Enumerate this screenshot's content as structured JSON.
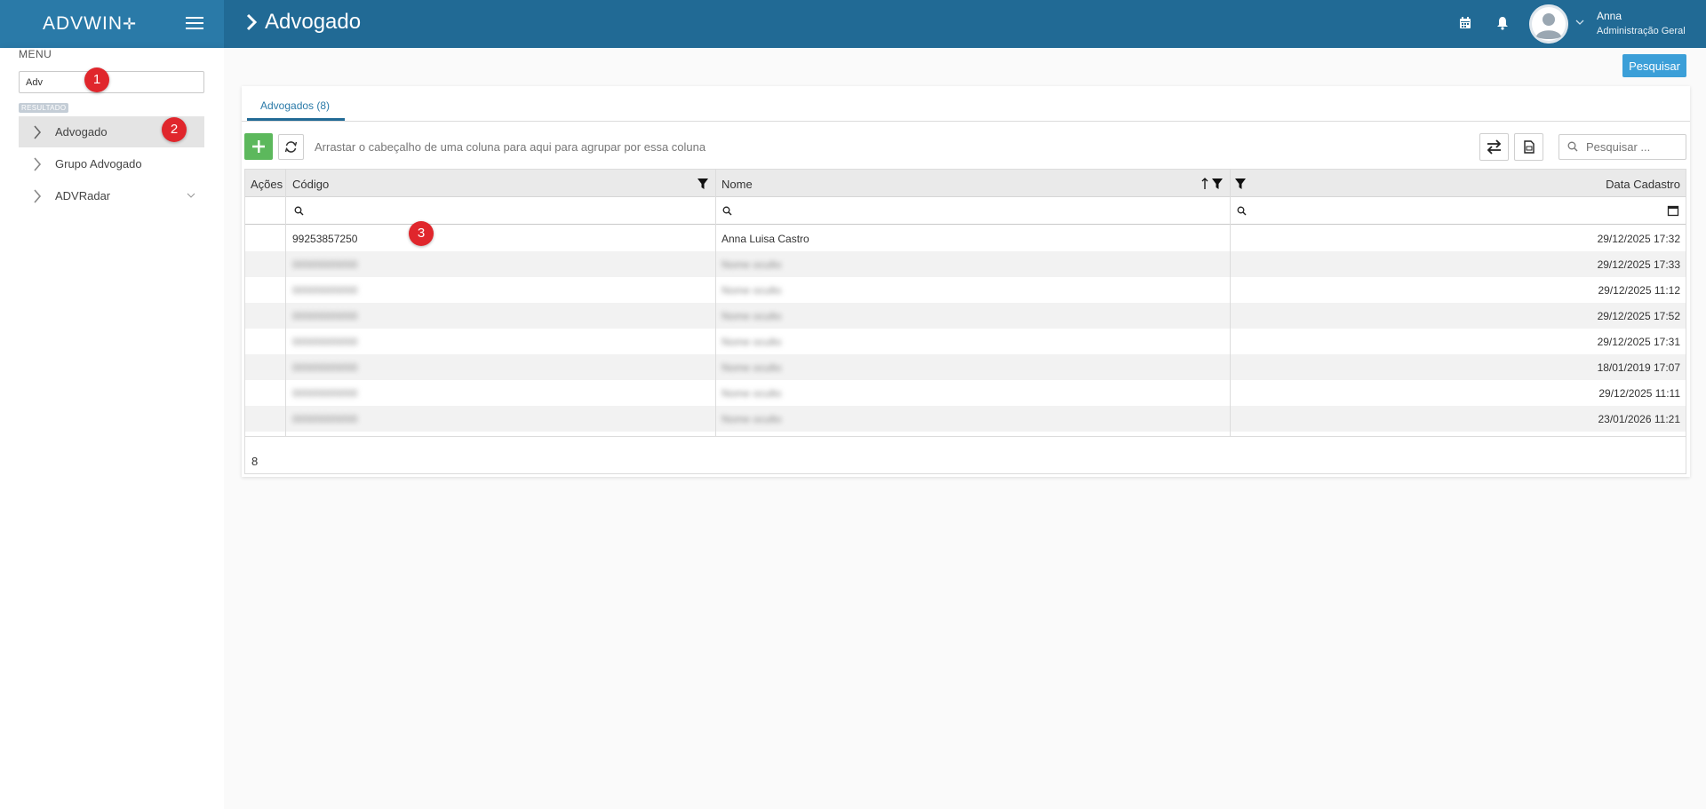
{
  "header": {
    "logo": "ADVWIN",
    "page_title": "Advogado",
    "user": {
      "name": "Anna",
      "role": "Administração Geral"
    }
  },
  "sidebar": {
    "menu_title": "MENU",
    "search_value": "Adv",
    "result_badge": "RESULTADO",
    "items": [
      {
        "label": "Advogado",
        "active": true
      },
      {
        "label": "Grupo Advogado",
        "active": false
      },
      {
        "label": "ADVRadar",
        "active": false
      }
    ]
  },
  "toolbar": {
    "search_button": "Pesquisar",
    "group_hint": "Arrastar o cabeçalho de uma coluna para aqui para agrupar por essa coluna",
    "grid_search_placeholder": "Pesquisar ..."
  },
  "tabs": [
    {
      "label": "Advogados (8)",
      "active": true
    }
  ],
  "grid": {
    "columns": [
      "Ações",
      "Código",
      "Nome",
      "",
      "Data Cadastro"
    ],
    "rows": [
      {
        "codigo": "99253857250",
        "nome": "Anna Luisa Castro",
        "data": "29/12/2025 17:32"
      },
      {
        "codigo": "00000000000",
        "nome": "Nome oculto",
        "data": "29/12/2025 17:33"
      },
      {
        "codigo": "00000000000",
        "nome": "Nome oculto",
        "data": "29/12/2025 11:12"
      },
      {
        "codigo": "00000000000",
        "nome": "Nome oculto",
        "data": "29/12/2025 17:52"
      },
      {
        "codigo": "00000000000",
        "nome": "Nome oculto",
        "data": "29/12/2025 17:31"
      },
      {
        "codigo": "00000000000",
        "nome": "Nome oculto",
        "data": "18/01/2019 17:07"
      },
      {
        "codigo": "00000000000",
        "nome": "Nome oculto",
        "data": "29/12/2025 11:11"
      },
      {
        "codigo": "00000000000",
        "nome": "Nome oculto",
        "data": "23/01/2026 11:21"
      }
    ],
    "footer_count": "8"
  },
  "markers": [
    "1",
    "2",
    "3"
  ],
  "colors": {
    "header": "#216a95",
    "brand": "#2a7aa8",
    "primary_button": "#3b9fd8",
    "add_button": "#5cb85c",
    "marker": "#e0262c"
  }
}
